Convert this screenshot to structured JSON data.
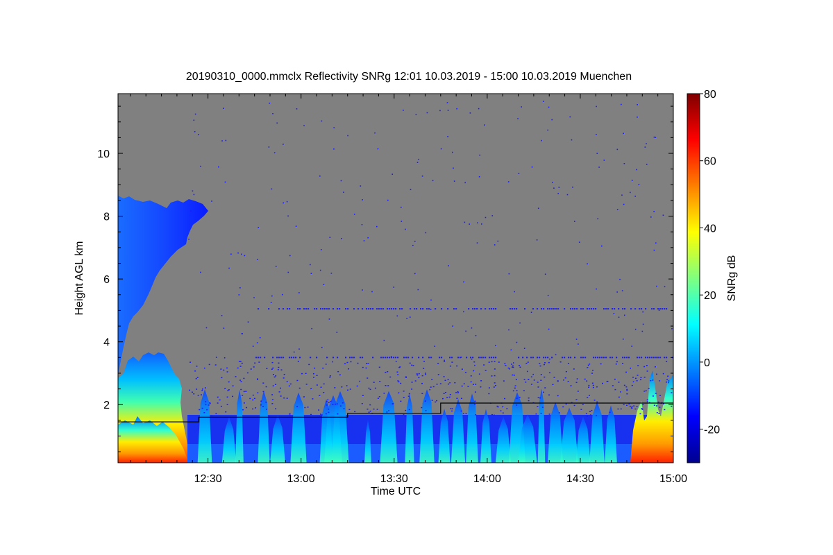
{
  "chart_data": {
    "type": "heatmap",
    "title": "20190310_0000.mmclx Reflectivity SNRg   12:01 10.03.2019 - 15:00 10.03.2019 Muenchen",
    "xlabel": "Time UTC",
    "ylabel": "Height AGL km",
    "colorbar_label": "SNRg dB",
    "xlim": [
      "12:01",
      "15:00"
    ],
    "ylim": [
      0.15,
      11.9
    ],
    "x_ticks": [
      "12:30",
      "13:00",
      "13:30",
      "14:00",
      "14:30",
      "15:00"
    ],
    "y_ticks": [
      2,
      4,
      6,
      8,
      10
    ],
    "colorbar_range": [
      -30,
      80
    ],
    "colorbar_ticks": [
      -20,
      0,
      20,
      40,
      60,
      80
    ],
    "colormap": [
      "#00008f",
      "#0000ff",
      "#007fff",
      "#00ffff",
      "#7fff7f",
      "#ffff00",
      "#ff7f00",
      "#ff0000",
      "#7f0000"
    ],
    "background_color": "#808080",
    "features": {
      "cirrus_top_km": 8.7,
      "persistent_echo_lines_km": [
        5.05,
        3.5
      ],
      "boundary_layer_line": [
        {
          "time": "12:01",
          "height_km": 1.45
        },
        {
          "time": "12:27",
          "height_km": 1.6
        },
        {
          "time": "13:15",
          "height_km": 1.72
        },
        {
          "time": "13:45",
          "height_km": 2.05
        },
        {
          "time": "15:00",
          "height_km": 2.05
        }
      ]
    }
  }
}
